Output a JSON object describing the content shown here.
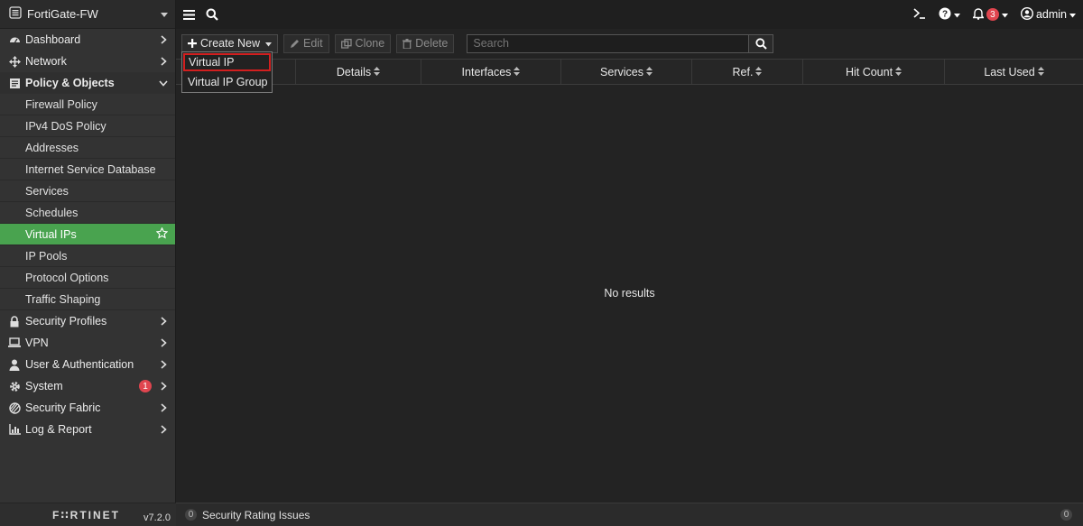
{
  "app": {
    "hostname": "FortiGate-FW",
    "brand": "F∷RTINET",
    "version": "v7.2.0"
  },
  "sidebar": {
    "items": [
      {
        "label": "Dashboard",
        "icon": "dashboard-icon"
      },
      {
        "label": "Network",
        "icon": "network-icon"
      },
      {
        "label": "Policy & Objects",
        "icon": "policy-icon",
        "expanded": true
      },
      {
        "label": "Security Profiles",
        "icon": "lock-icon"
      },
      {
        "label": "VPN",
        "icon": "laptop-icon"
      },
      {
        "label": "User & Authentication",
        "icon": "user-icon"
      },
      {
        "label": "System",
        "icon": "gear-icon",
        "badge": "1"
      },
      {
        "label": "Security Fabric",
        "icon": "fabric-icon"
      },
      {
        "label": "Log & Report",
        "icon": "chart-icon"
      }
    ],
    "subitems": [
      {
        "label": "Firewall Policy"
      },
      {
        "label": "IPv4 DoS Policy"
      },
      {
        "label": "Addresses"
      },
      {
        "label": "Internet Service Database"
      },
      {
        "label": "Services"
      },
      {
        "label": "Schedules"
      },
      {
        "label": "Virtual IPs",
        "active": true
      },
      {
        "label": "IP Pools"
      },
      {
        "label": "Protocol Options"
      },
      {
        "label": "Traffic Shaping"
      }
    ]
  },
  "topbar": {
    "cli_icon": "cli-icon",
    "alerts_count": "3",
    "user": "admin"
  },
  "toolbar": {
    "create_new": "Create New",
    "edit": "Edit",
    "clone": "Clone",
    "delete": "Delete",
    "search_placeholder": "Search"
  },
  "dropdown": {
    "items": [
      "Virtual IP",
      "Virtual IP Group"
    ]
  },
  "table": {
    "columns": [
      "",
      "Details",
      "Interfaces",
      "Services",
      "Ref.",
      "Hit Count",
      "Last Used"
    ],
    "empty_text": "No results"
  },
  "status": {
    "security_rating_count": "0",
    "security_rating_label": "Security Rating Issues",
    "right_count": "0"
  },
  "colors": {
    "accent_green": "#49a34f",
    "highlight_red": "#d21f1f",
    "badge_red": "#e0454f"
  }
}
